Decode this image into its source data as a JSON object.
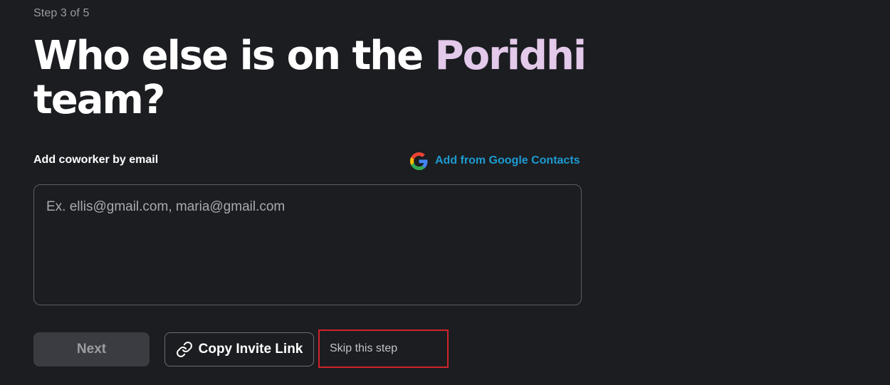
{
  "step_indicator": "Step 3 of 5",
  "heading": {
    "text_before": "Who else is on the ",
    "workspace_name": "Poridhi",
    "text_after": " team?",
    "accent_color": "#e3c9ea"
  },
  "email_section": {
    "label": "Add coworker by email",
    "google_contacts_label": "Add from Google Contacts",
    "google_icon": "google-g-icon",
    "placeholder": "Ex. ellis@gmail.com, maria@gmail.com",
    "value": ""
  },
  "actions": {
    "next_label": "Next",
    "copy_invite_label": "Copy Invite Link",
    "copy_invite_icon": "link-icon",
    "skip_label": "Skip this step"
  },
  "colors": {
    "background": "#1b1d21",
    "link": "#1d9bd1",
    "highlight_border": "#d0232b"
  }
}
